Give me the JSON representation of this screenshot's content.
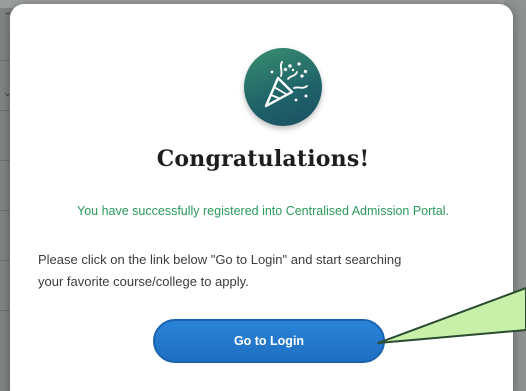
{
  "modal": {
    "icon": "party-popper-icon",
    "title": "Congratulations!",
    "success_message": "You have successfully registered into Centralised Admission Portal.",
    "instructions_line1": "Please click on the link below \"Go to Login\" and start searching",
    "instructions_line2": "your favorite course/college to apply.",
    "login_button_label": "Go to Login"
  },
  "colors": {
    "success_green": "#2a9a5a",
    "button_blue": "#1f6fc2",
    "badge_teal": "#21656a",
    "callout_green": "#c8f0a8"
  }
}
